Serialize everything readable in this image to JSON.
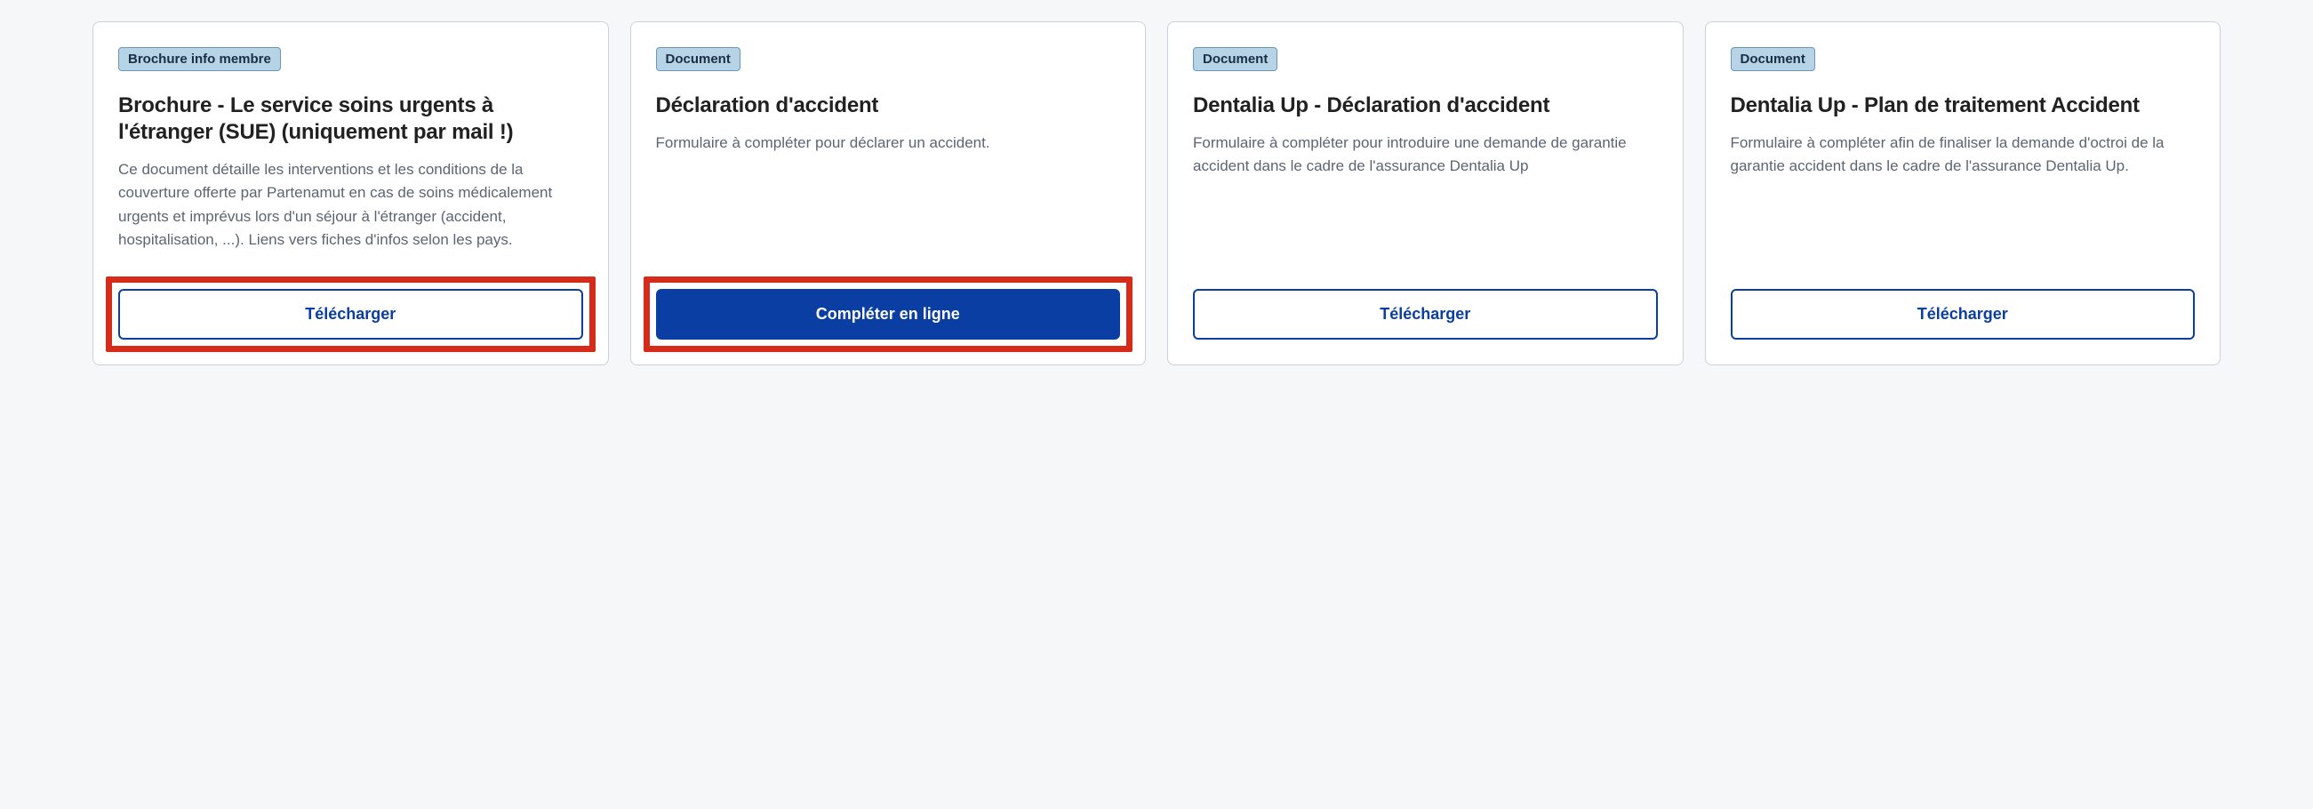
{
  "cards": [
    {
      "chip": "Brochure info membre",
      "title": "Brochure - Le service soins urgents à l'étranger (SUE) (uniquement par mail !)",
      "desc": "Ce document détaille les interventions et les conditions de la couverture offerte par Partenamut en cas de soins médicalement urgents et imprévus lors d'un séjour à l'étranger (accident, hospitalisation, ...). Liens vers fiches d'infos selon les pays.",
      "button": "Télécharger"
    },
    {
      "chip": "Document",
      "title": "Déclaration d'accident",
      "desc": "Formulaire à compléter pour déclarer un accident.",
      "button": "Compléter en ligne"
    },
    {
      "chip": "Document",
      "title": "Dentalia Up - Déclaration d'accident",
      "desc": "Formulaire à compléter pour introduire une demande de garantie accident dans le cadre de l'assurance Dentalia Up",
      "button": "Télécharger"
    },
    {
      "chip": "Document",
      "title": "Dentalia Up - Plan de traitement Accident",
      "desc": "Formulaire à compléter afin de finaliser la demande d'octroi de la garantie accident dans le cadre de l'assurance Dentalia Up.",
      "button": "Télécharger"
    }
  ]
}
